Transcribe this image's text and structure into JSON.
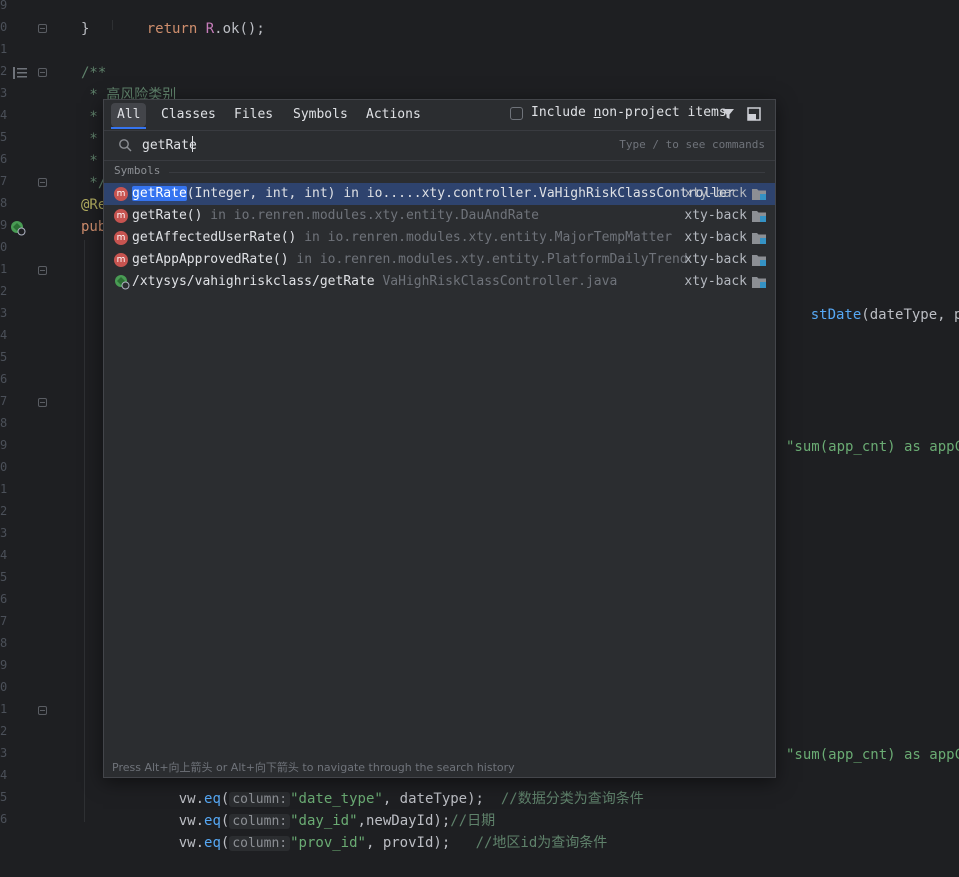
{
  "editor": {
    "line_numbers": [
      "9",
      "0",
      "1",
      "2",
      "3",
      "4",
      "5",
      "6",
      "7",
      "8",
      "9",
      "0",
      "1",
      "2",
      "3",
      "4",
      "5",
      "6",
      "7",
      "8",
      "9",
      "0",
      "1",
      "2",
      "3",
      "4",
      "5",
      "6",
      "7",
      "8",
      "9",
      "0",
      "1",
      "2",
      "3",
      "4",
      "5",
      "6"
    ],
    "return_kw": "return",
    "return_obj": "R",
    "return_call": ".ok();",
    "close_brace": "}",
    "doc_open": "/**",
    "doc_line1": " * 高风险类别",
    "doc_star": " *",
    "doc_close": " */",
    "annotation": "@Re",
    "pub": "pub",
    "right_call_fn": "stDate",
    "right_call_args": "(dateType, provIc",
    "sum_str1": "\"sum(app_cnt) as appCr",
    "sum_str2": "\"sum(app_cnt) as appCr",
    "vw_line_a_obj": "vw.",
    "vw_line_a_fn": "eq",
    "vw_line_a_hint": "column:",
    "vw_line_a_str": "\"date_type\"",
    "vw_line_a_rest": ", dateType);",
    "vw_line_a_comment": "//数据分类为查询条件",
    "vw_line_b_obj": "vw.",
    "vw_line_b_fn": "eq",
    "vw_line_b_hint": "column:",
    "vw_line_b_str": "\"day_id\"",
    "vw_line_b_rest": ",newDayId);",
    "vw_line_b_comment": "//日期",
    "vw_line_c_obj": "vw.",
    "vw_line_c_fn": "eq",
    "vw_line_c_hint": "column:",
    "vw_line_c_str": "\"prov_id\"",
    "vw_line_c_rest": ", provId);",
    "vw_line_c_comment": "//地区id为查询条件"
  },
  "popup": {
    "tabs": [
      {
        "label": "All",
        "active": true
      },
      {
        "label": "Classes"
      },
      {
        "label": "Files"
      },
      {
        "label": "Symbols"
      },
      {
        "label": "Actions"
      }
    ],
    "include_label_pre": "Include ",
    "include_label_u": "n",
    "include_label_post": "on-project items",
    "search_value": "getRate",
    "search_hint": "Type / to see commands",
    "section_title": "Symbols",
    "results": [
      {
        "icon": "m",
        "match": "getRate",
        "rest": "(Integer, int, int) in io.....xty.controller.VaHighRiskClassController",
        "loc": "",
        "module": "xty-back",
        "selected": true
      },
      {
        "icon": "m",
        "match": "",
        "rest": "getRate()",
        "loc": " in io.renren.modules.xty.entity.DauAndRate",
        "module": "xty-back"
      },
      {
        "icon": "m",
        "match": "",
        "rest": "getAffectedUserRate()",
        "loc": " in io.renren.modules.xty.entity.MajorTempMatter",
        "module": "xty-back"
      },
      {
        "icon": "m",
        "match": "",
        "rest": "getAppApprovedRate()",
        "loc": " in io.renren.modules.xty.entity.PlatformDailyTrend",
        "module": "xty-back"
      },
      {
        "icon": "web",
        "match": "",
        "rest": "/xtysys/vahighriskclass/getRate",
        "loc": " VaHighRiskClassController.java",
        "module": "xty-back"
      }
    ],
    "footer": "Press Alt+向上箭头 or Alt+向下箭头 to navigate through the search history",
    "colors": {
      "accent": "#3574f0",
      "selected_row": "#2e436e",
      "method_badge": "#c75450"
    }
  }
}
